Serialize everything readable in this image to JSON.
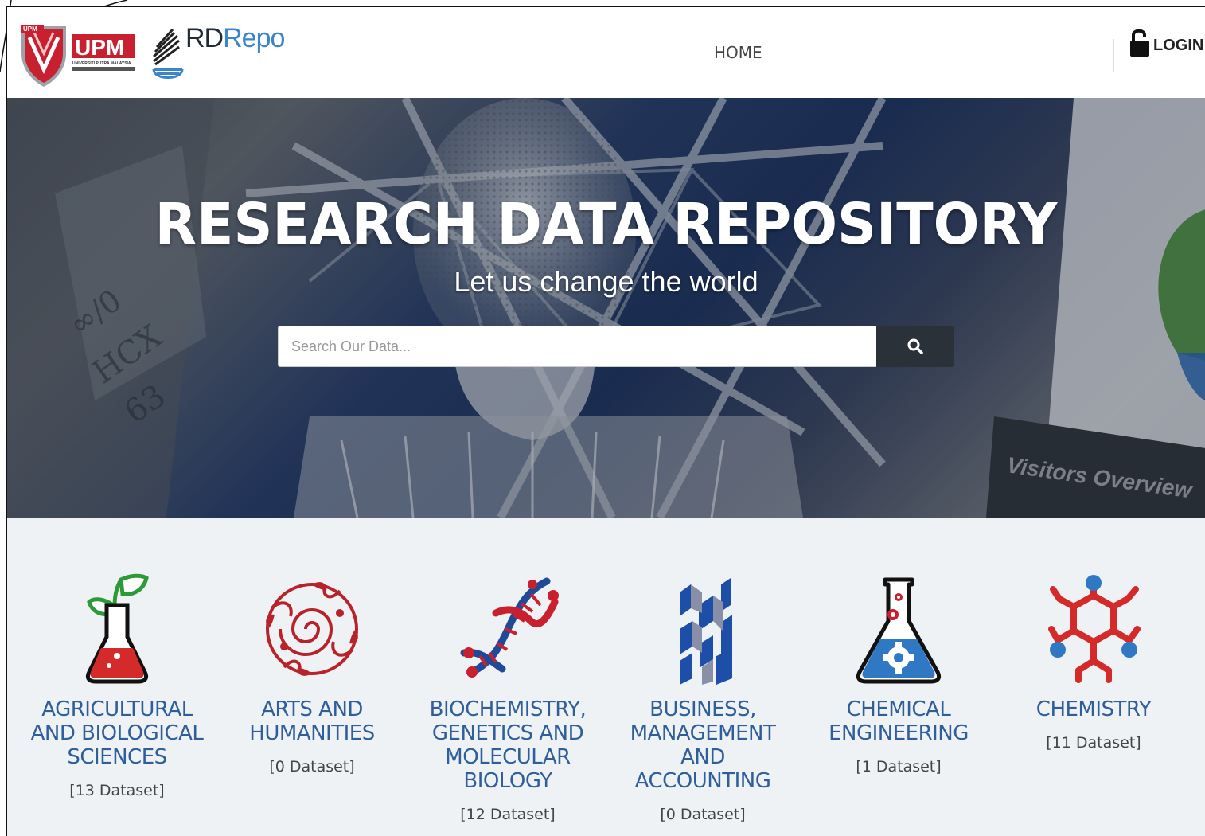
{
  "header": {
    "upm_logo_text": "UPM",
    "upm_logo_subtext": "UNIVERSITI PUTRA MALAYSIA",
    "brand_rd": "RD",
    "brand_repo": "Repo",
    "nav_home": "HOME",
    "login_label": "LOGIN"
  },
  "hero": {
    "title": "RESEARCH DATA REPOSITORY",
    "subtitle": "Let us change the world",
    "search_placeholder": "Search Our Data...",
    "background_text": "Visitors Overview"
  },
  "categories": [
    {
      "name": "AGRICULTURAL AND BIOLOGICAL SCIENCES",
      "count": "[13 Dataset]",
      "icon": "plant-flask-icon"
    },
    {
      "name": "ARTS AND HUMANITIES",
      "count": "[0 Dataset]",
      "icon": "ornament-swirl-icon"
    },
    {
      "name": "BIOCHEMISTRY, GENETICS AND MOLECULAR BIOLOGY",
      "count": "[12 Dataset]",
      "icon": "dna-icon"
    },
    {
      "name": "BUSINESS, MANAGEMENT AND ACCOUNTING",
      "count": "[0 Dataset]",
      "icon": "blocks-icon"
    },
    {
      "name": "CHEMICAL ENGINEERING",
      "count": "[1 Dataset]",
      "icon": "gear-flask-icon"
    },
    {
      "name": "CHEMISTRY",
      "count": "[11 Dataset]",
      "icon": "molecule-icon"
    }
  ],
  "colors": {
    "category_text": "#2f5f9a",
    "search_button": "#2b3138",
    "brand_blue": "#3a86c8",
    "upm_red": "#c8202f"
  }
}
